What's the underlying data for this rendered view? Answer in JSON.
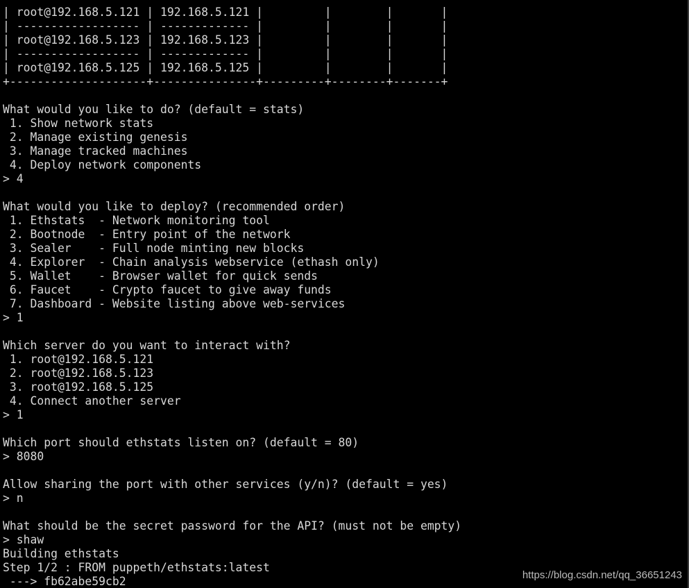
{
  "terminal": {
    "lines": [
      "| root@192.168.5.121 | 192.168.5.121 |         |        |       |",
      "| ------------------ | ------------- |         |        |       |",
      "| root@192.168.5.123 | 192.168.5.123 |         |        |       |",
      "| ------------------ | ------------- |         |        |       |",
      "| root@192.168.5.125 | 192.168.5.125 |         |        |       |",
      "+--------------------+---------------+---------+--------+-------+",
      "",
      "What would you like to do? (default = stats)",
      " 1. Show network stats",
      " 2. Manage existing genesis",
      " 3. Manage tracked machines",
      " 4. Deploy network components",
      "> 4",
      "",
      "What would you like to deploy? (recommended order)",
      " 1. Ethstats  - Network monitoring tool",
      " 2. Bootnode  - Entry point of the network",
      " 3. Sealer    - Full node minting new blocks",
      " 4. Explorer  - Chain analysis webservice (ethash only)",
      " 5. Wallet    - Browser wallet for quick sends",
      " 6. Faucet    - Crypto faucet to give away funds",
      " 7. Dashboard - Website listing above web-services",
      "> 1",
      "",
      "Which server do you want to interact with?",
      " 1. root@192.168.5.121",
      " 2. root@192.168.5.123",
      " 3. root@192.168.5.125",
      " 4. Connect another server",
      "> 1",
      "",
      "Which port should ethstats listen on? (default = 80)",
      "> 8080",
      "",
      "Allow sharing the port with other services (y/n)? (default = yes)",
      "> n",
      "",
      "What should be the secret password for the API? (must not be empty)",
      "> shaw",
      "Building ethstats",
      "Step 1/2 : FROM puppeth/ethstats:latest",
      " ---> fb62abe59cb2"
    ]
  },
  "watermark": "https://blog.csdn.net/qq_36651243"
}
